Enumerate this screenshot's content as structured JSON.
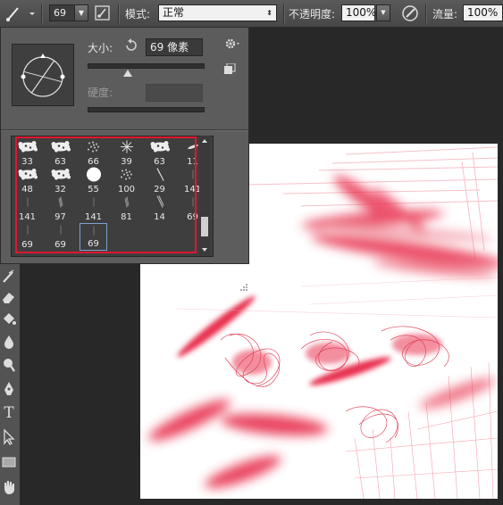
{
  "options_bar": {
    "brush_size": "69",
    "mode_label": "模式:",
    "mode_value": "正常",
    "opacity_label": "不透明度:",
    "opacity_value": "100%",
    "flow_label": "流量:",
    "flow_value": "100%"
  },
  "brush_panel": {
    "size_label": "大小:",
    "size_value": "69 像素",
    "size_slider_fraction": 0.35,
    "hardness_label": "硬度:",
    "hardness_value": ""
  },
  "brush_presets": [
    {
      "num": "33",
      "kind": "splatter"
    },
    {
      "num": "63",
      "kind": "splatter"
    },
    {
      "num": "66",
      "kind": "scatter"
    },
    {
      "num": "39",
      "kind": "star"
    },
    {
      "num": "63",
      "kind": "splatter"
    },
    {
      "num": "11",
      "kind": "leaf"
    },
    {
      "num": "48",
      "kind": "splatter"
    },
    {
      "num": "32",
      "kind": "splatter"
    },
    {
      "num": "55",
      "kind": "round"
    },
    {
      "num": "100",
      "kind": "scatter"
    },
    {
      "num": "29",
      "kind": "stroke"
    },
    {
      "num": "141",
      "kind": "tick"
    },
    {
      "num": "141",
      "kind": "tick"
    },
    {
      "num": "97",
      "kind": "hair"
    },
    {
      "num": "141",
      "kind": "tick"
    },
    {
      "num": "81",
      "kind": "hair"
    },
    {
      "num": "14",
      "kind": "streak"
    },
    {
      "num": "69",
      "kind": "tick"
    },
    {
      "num": "69",
      "kind": "tick"
    },
    {
      "num": "69",
      "kind": "tick"
    },
    {
      "num": "69",
      "kind": "tick",
      "selected": true
    }
  ],
  "tools": [
    "brush-tool-icon",
    "eraser-tool-icon",
    "paint-bucket-tool-icon",
    "blur-tool-icon",
    "dodge-tool-icon",
    "pen-tool-icon",
    "type-tool-icon",
    "path-selection-tool-icon",
    "rectangle-tool-icon",
    "hand-tool-icon"
  ],
  "colors": {
    "accent_red": "#e0172f",
    "paint": "#e8324f",
    "ui_panel": "#5d5d5d",
    "selection": "#7da2ce"
  }
}
